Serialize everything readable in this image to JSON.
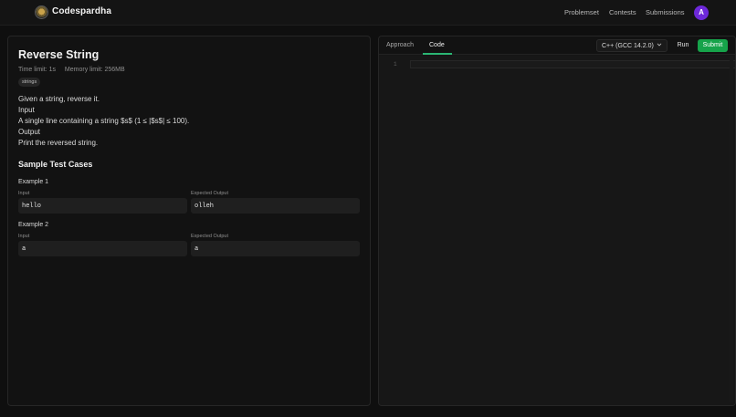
{
  "header": {
    "brand": "Codespardha",
    "nav": [
      "Problemset",
      "Contests",
      "Submissions"
    ],
    "avatar_initial": "A",
    "avatar_color": "#6d28d9"
  },
  "problem": {
    "title": "Reverse String",
    "time_limit": "Time limit: 1s",
    "memory_limit": "Memory limit: 256MB",
    "tag": "strings",
    "description": [
      "Given a string, reverse it.",
      "Input",
      "A single line containing a string $s$ (1 ≤ |$s$| ≤ 100).",
      "Output",
      "Print the reversed string."
    ],
    "samples_title": "Sample Test Cases",
    "input_label": "Input",
    "output_label": "Expected Output",
    "examples": [
      {
        "title": "Example 1",
        "input": "hello",
        "output": "olleh"
      },
      {
        "title": "Example 2",
        "input": "a",
        "output": "a"
      }
    ]
  },
  "editor": {
    "tabs": [
      "Approach",
      "Code"
    ],
    "active_tab": "Code",
    "language": "C++ (GCC 14.2.0)",
    "run_label": "Run",
    "submit_label": "Submit",
    "submit_color": "#16a34a",
    "line_numbers": [
      "1"
    ]
  }
}
